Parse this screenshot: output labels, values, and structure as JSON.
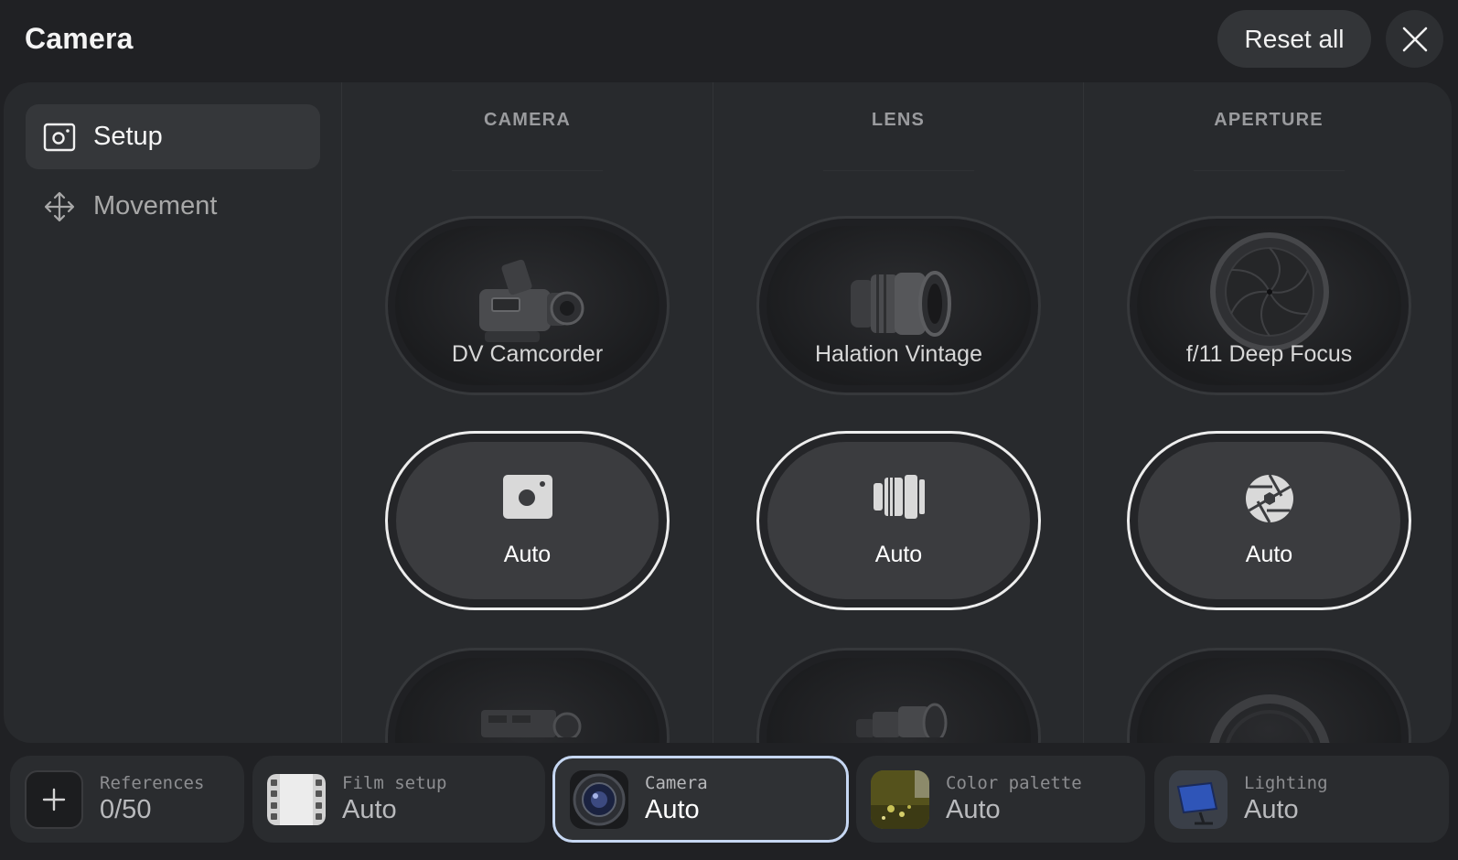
{
  "header": {
    "title": "Camera",
    "reset_label": "Reset all",
    "close_icon": "close-icon"
  },
  "sidebar": {
    "items": [
      {
        "label": "Setup",
        "icon": "camera-frame-icon",
        "active": true
      },
      {
        "label": "Movement",
        "icon": "move-arrows-icon",
        "active": false
      }
    ]
  },
  "columns": [
    {
      "heading": "CAMERA",
      "options": [
        {
          "label": "DV Camcorder",
          "image": "camcorder-image",
          "state": "unselected"
        },
        {
          "label": "Auto",
          "icon": "camera-auto-icon",
          "state": "selected"
        },
        {
          "label": "",
          "image": "cinema-camera-image",
          "state": "partially-visible"
        }
      ]
    },
    {
      "heading": "LENS",
      "options": [
        {
          "label": "Halation Vintage",
          "image": "vintage-lens-image",
          "state": "unselected"
        },
        {
          "label": "Auto",
          "icon": "lens-auto-icon",
          "state": "selected"
        },
        {
          "label": "",
          "image": "lens-image",
          "state": "partially-visible"
        }
      ]
    },
    {
      "heading": "APERTURE",
      "options": [
        {
          "label": "f/11 Deep Focus",
          "image": "aperture-blades-image",
          "state": "unselected"
        },
        {
          "label": "Auto",
          "icon": "aperture-auto-icon",
          "state": "selected"
        },
        {
          "label": "",
          "image": "lens-ring-image",
          "state": "partially-visible"
        }
      ]
    }
  ],
  "bottom_bar": [
    {
      "label": "References",
      "value": "0/50",
      "thumb": "plus-icon",
      "selected": false
    },
    {
      "label": "Film setup",
      "value": "Auto",
      "thumb": "film-strip-icon",
      "selected": false
    },
    {
      "label": "Camera",
      "value": "Auto",
      "thumb": "lens-thumb-icon",
      "selected": true
    },
    {
      "label": "Color palette",
      "value": "Auto",
      "thumb": "palette-thumb-image",
      "selected": false
    },
    {
      "label": "Lighting",
      "value": "Auto",
      "thumb": "light-panel-icon",
      "selected": false
    }
  ],
  "colors": {
    "background": "#202124",
    "panel": "#282a2d",
    "selected_border": "#ededed",
    "bottom_selected_border": "#c6d7f2"
  }
}
